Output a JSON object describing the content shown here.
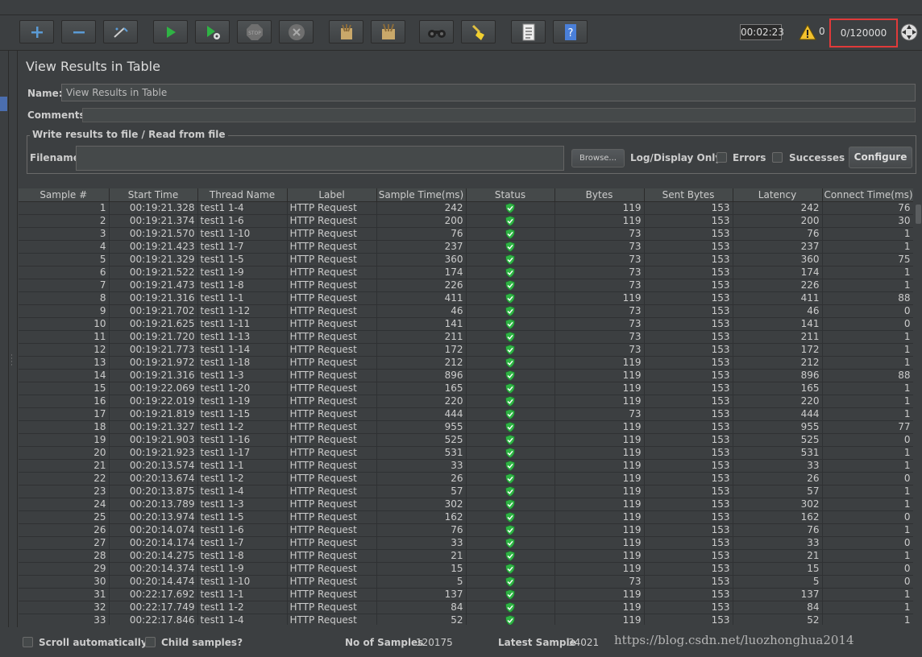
{
  "toolbar": {
    "buttons": [
      {
        "icon": "plus-icon"
      },
      {
        "icon": "minus-icon"
      },
      {
        "icon": "toggle-wand-icon"
      },
      {
        "icon": "start-icon"
      },
      {
        "icon": "start-no-pause-icon"
      },
      {
        "icon": "stop-icon"
      },
      {
        "icon": "shutdown-icon"
      },
      {
        "icon": "clear-icon"
      },
      {
        "icon": "clear-all-icon"
      },
      {
        "icon": "search-binoculars-icon"
      },
      {
        "icon": "reset-search-broom-icon"
      },
      {
        "icon": "function-helper-icon"
      },
      {
        "icon": "help-icon"
      }
    ],
    "elapsed_time": "00:02:23",
    "warning_count": "0",
    "active_threads": "0/120000"
  },
  "panel": {
    "title": "View Results in Table",
    "name_label": "Name:",
    "name_value": "View Results in Table",
    "comments_label": "Comments:",
    "file_group_title": "Write results to file / Read from file",
    "filename_label": "Filename",
    "filename_value": "",
    "browse_label": "Browse...",
    "log_display_label": "Log/Display Only:",
    "errors_label": "Errors",
    "successes_label": "Successes",
    "configure_label": "Configure"
  },
  "table": {
    "columns": [
      "Sample #",
      "Start Time",
      "Thread Name",
      "Label",
      "Sample Time(ms)",
      "Status",
      "Bytes",
      "Sent Bytes",
      "Latency",
      "Connect Time(ms)"
    ],
    "status_icon": "success-shield-icon",
    "rows": [
      [
        "1",
        "00:19:21.328",
        "test1 1-4",
        "HTTP Request",
        "242",
        "ok",
        "119",
        "153",
        "242",
        "76"
      ],
      [
        "2",
        "00:19:21.374",
        "test1 1-6",
        "HTTP Request",
        "200",
        "ok",
        "119",
        "153",
        "200",
        "30"
      ],
      [
        "3",
        "00:19:21.570",
        "test1 1-10",
        "HTTP Request",
        "76",
        "ok",
        "73",
        "153",
        "76",
        "1"
      ],
      [
        "4",
        "00:19:21.423",
        "test1 1-7",
        "HTTP Request",
        "237",
        "ok",
        "73",
        "153",
        "237",
        "1"
      ],
      [
        "5",
        "00:19:21.329",
        "test1 1-5",
        "HTTP Request",
        "360",
        "ok",
        "73",
        "153",
        "360",
        "75"
      ],
      [
        "6",
        "00:19:21.522",
        "test1 1-9",
        "HTTP Request",
        "174",
        "ok",
        "73",
        "153",
        "174",
        "1"
      ],
      [
        "7",
        "00:19:21.473",
        "test1 1-8",
        "HTTP Request",
        "226",
        "ok",
        "73",
        "153",
        "226",
        "1"
      ],
      [
        "8",
        "00:19:21.316",
        "test1 1-1",
        "HTTP Request",
        "411",
        "ok",
        "119",
        "153",
        "411",
        "88"
      ],
      [
        "9",
        "00:19:21.702",
        "test1 1-12",
        "HTTP Request",
        "46",
        "ok",
        "73",
        "153",
        "46",
        "0"
      ],
      [
        "10",
        "00:19:21.625",
        "test1 1-11",
        "HTTP Request",
        "141",
        "ok",
        "73",
        "153",
        "141",
        "0"
      ],
      [
        "11",
        "00:19:21.720",
        "test1 1-13",
        "HTTP Request",
        "211",
        "ok",
        "73",
        "153",
        "211",
        "1"
      ],
      [
        "12",
        "00:19:21.773",
        "test1 1-14",
        "HTTP Request",
        "172",
        "ok",
        "73",
        "153",
        "172",
        "1"
      ],
      [
        "13",
        "00:19:21.972",
        "test1 1-18",
        "HTTP Request",
        "212",
        "ok",
        "119",
        "153",
        "212",
        "1"
      ],
      [
        "14",
        "00:19:21.316",
        "test1 1-3",
        "HTTP Request",
        "896",
        "ok",
        "119",
        "153",
        "896",
        "88"
      ],
      [
        "15",
        "00:19:22.069",
        "test1 1-20",
        "HTTP Request",
        "165",
        "ok",
        "119",
        "153",
        "165",
        "1"
      ],
      [
        "16",
        "00:19:22.019",
        "test1 1-19",
        "HTTP Request",
        "220",
        "ok",
        "119",
        "153",
        "220",
        "1"
      ],
      [
        "17",
        "00:19:21.819",
        "test1 1-15",
        "HTTP Request",
        "444",
        "ok",
        "73",
        "153",
        "444",
        "1"
      ],
      [
        "18",
        "00:19:21.327",
        "test1 1-2",
        "HTTP Request",
        "955",
        "ok",
        "119",
        "153",
        "955",
        "77"
      ],
      [
        "19",
        "00:19:21.903",
        "test1 1-16",
        "HTTP Request",
        "525",
        "ok",
        "119",
        "153",
        "525",
        "0"
      ],
      [
        "20",
        "00:19:21.923",
        "test1 1-17",
        "HTTP Request",
        "531",
        "ok",
        "119",
        "153",
        "531",
        "1"
      ],
      [
        "21",
        "00:20:13.574",
        "test1 1-1",
        "HTTP Request",
        "33",
        "ok",
        "119",
        "153",
        "33",
        "1"
      ],
      [
        "22",
        "00:20:13.674",
        "test1 1-2",
        "HTTP Request",
        "26",
        "ok",
        "119",
        "153",
        "26",
        "0"
      ],
      [
        "23",
        "00:20:13.875",
        "test1 1-4",
        "HTTP Request",
        "57",
        "ok",
        "119",
        "153",
        "57",
        "1"
      ],
      [
        "24",
        "00:20:13.789",
        "test1 1-3",
        "HTTP Request",
        "302",
        "ok",
        "119",
        "153",
        "302",
        "1"
      ],
      [
        "25",
        "00:20:13.974",
        "test1 1-5",
        "HTTP Request",
        "162",
        "ok",
        "119",
        "153",
        "162",
        "0"
      ],
      [
        "26",
        "00:20:14.074",
        "test1 1-6",
        "HTTP Request",
        "76",
        "ok",
        "119",
        "153",
        "76",
        "1"
      ],
      [
        "27",
        "00:20:14.174",
        "test1 1-7",
        "HTTP Request",
        "33",
        "ok",
        "119",
        "153",
        "33",
        "0"
      ],
      [
        "28",
        "00:20:14.275",
        "test1 1-8",
        "HTTP Request",
        "21",
        "ok",
        "119",
        "153",
        "21",
        "1"
      ],
      [
        "29",
        "00:20:14.374",
        "test1 1-9",
        "HTTP Request",
        "15",
        "ok",
        "119",
        "153",
        "15",
        "0"
      ],
      [
        "30",
        "00:20:14.474",
        "test1 1-10",
        "HTTP Request",
        "5",
        "ok",
        "73",
        "153",
        "5",
        "0"
      ],
      [
        "31",
        "00:22:17.692",
        "test1 1-1",
        "HTTP Request",
        "137",
        "ok",
        "119",
        "153",
        "137",
        "1"
      ],
      [
        "32",
        "00:22:17.749",
        "test1 1-2",
        "HTTP Request",
        "84",
        "ok",
        "119",
        "153",
        "84",
        "1"
      ],
      [
        "33",
        "00:22:17.846",
        "test1 1-4",
        "HTTP Request",
        "52",
        "ok",
        "119",
        "153",
        "52",
        "1"
      ]
    ]
  },
  "footer": {
    "scroll_auto_label": "Scroll automatically?",
    "child_samples_label": "Child samples?",
    "no_samples_label": "No of Samples",
    "no_samples_value": "120175",
    "latest_sample_label": "Latest Sample",
    "latest_sample_value": "34021",
    "watermark": "https://blog.csdn.net/luozhonghua2014"
  },
  "colors": {
    "background": "#3c3f41",
    "field": "#45494a",
    "text": "#cccccc",
    "highlight_border": "#e03a3a",
    "success_green": "#2fb344"
  }
}
